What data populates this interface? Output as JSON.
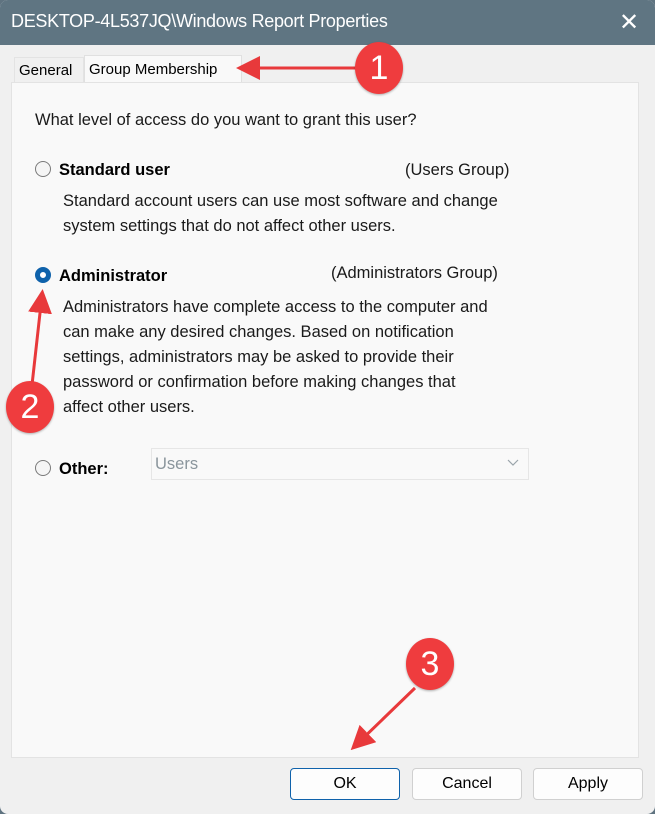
{
  "window": {
    "title": "DESKTOP-4L537JQ\\Windows Report Properties",
    "close_glyph": "✕"
  },
  "tabs": [
    {
      "label": "General",
      "active": false
    },
    {
      "label": "Group Membership",
      "active": true
    }
  ],
  "panel": {
    "question": "What level of access do you want to grant this user?",
    "options": [
      {
        "label": "Standard user",
        "group": "(Users Group)",
        "checked": false,
        "description": [
          "Standard account users can use most software and change",
          "system settings that do not affect other users."
        ]
      },
      {
        "label": "Administrator",
        "group": "(Administrators Group)",
        "checked": true,
        "description": [
          "Administrators have complete access to the computer and",
          "can make any desired changes. Based on notification",
          "settings, administrators may be asked to provide their",
          "password or confirmation before making changes that",
          "affect other users."
        ]
      },
      {
        "label": "Other:",
        "checked": false,
        "combo_value": "Users"
      }
    ]
  },
  "buttons": {
    "ok": "OK",
    "cancel": "Cancel",
    "apply": "Apply"
  },
  "annotations": {
    "badge_1": "1",
    "badge_2": "2",
    "badge_3": "3",
    "color": "#ef3c3e"
  }
}
